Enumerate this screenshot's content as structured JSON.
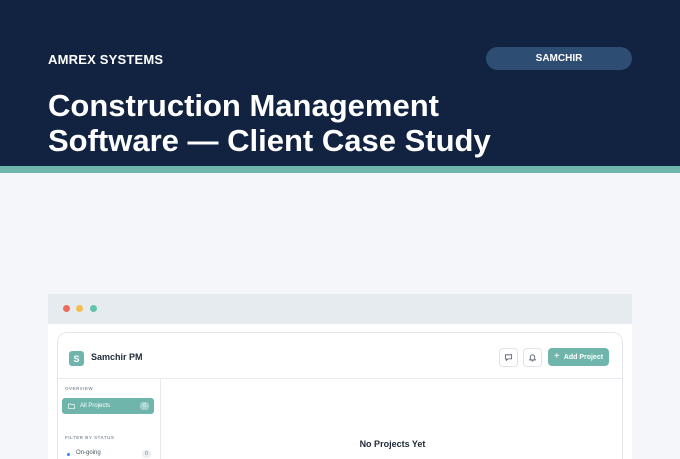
{
  "hero": {
    "brand": "AMREX SYSTEMS",
    "tag": "SAMCHIR",
    "headline_line1": "Construction Management",
    "headline_line2": "Software — Client Case Study"
  },
  "app": {
    "logo_letter": "S",
    "name": "Samchir PM",
    "add_button_label": "Add Project",
    "sidebar": {
      "overview_heading": "OVERVIEW",
      "active_item_label": "All Projects",
      "active_item_count": "0",
      "filter_heading": "FILTER BY STATUS",
      "status_items": [
        {
          "label": "On-going",
          "count": "0"
        }
      ]
    },
    "empty_state_title": "No Projects Yet"
  },
  "colors": {
    "hero_bg": "#112341",
    "accent": "#6fb5ac",
    "pill_bg": "#2e4d72",
    "page_bg": "#f4f6f9"
  },
  "icons": [
    "folder-icon",
    "chat-icon",
    "bell-icon",
    "plus-icon"
  ]
}
